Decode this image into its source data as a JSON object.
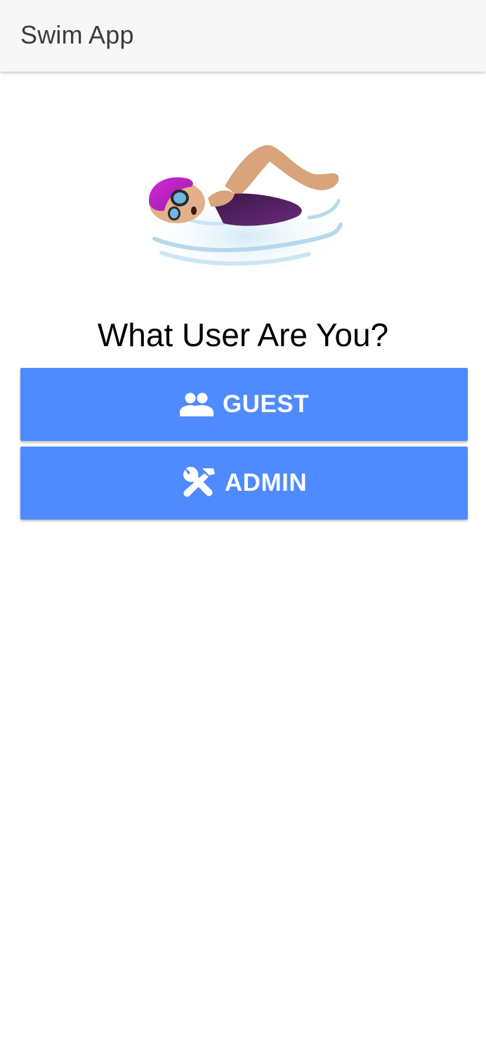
{
  "app_bar": {
    "title": "Swim App"
  },
  "hero": {
    "icon": "swimmer-emoji"
  },
  "prompt": {
    "question": "What User Are You?"
  },
  "buttons": {
    "guest": {
      "label": "GUEST",
      "icon": "people-icon"
    },
    "admin": {
      "label": "ADMIN",
      "icon": "tools-icon"
    }
  },
  "colors": {
    "accent": "#4f8bff",
    "app_bar_bg": "#f7f7f7",
    "title_text": "#3c3c3c"
  }
}
